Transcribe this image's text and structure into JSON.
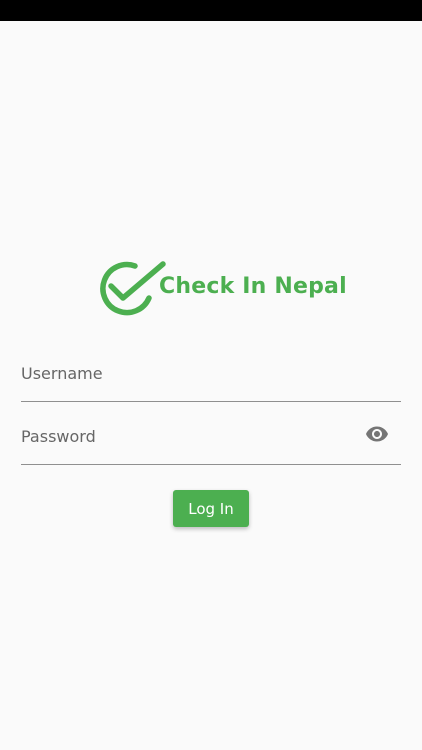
{
  "app": {
    "name": "Check In Nepal",
    "brand_color": "#4caf50"
  },
  "logo": {
    "icon": "check-circle-icon",
    "text": "Check In Nepal"
  },
  "form": {
    "username": {
      "placeholder": "Username",
      "value": ""
    },
    "password": {
      "placeholder": "Password",
      "value": "",
      "toggle_icon": "eye-icon"
    },
    "login_label": "Log In"
  }
}
